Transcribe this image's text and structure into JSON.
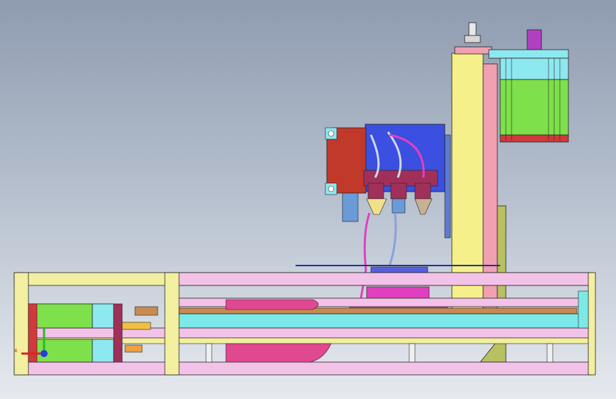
{
  "scene": {
    "type": "cad-assembly-side-view",
    "background_top": "#8f9bb0",
    "background_bottom": "#e6eaef",
    "axis_triad": {
      "x_color": "#e02020",
      "y_color": "#20c020",
      "z_color": "#2040e0"
    }
  },
  "colors": {
    "frame_rail": "#f3c2e8",
    "frame_yellow": "#f2f0a0",
    "cyan": "#7de8e8",
    "green": "#7ee04a",
    "column": "#f5f08a",
    "column_pink": "#f0a0b0",
    "motor_green": "#7ee04a",
    "motor_cyan": "#8ee8f0",
    "motor_red": "#d03a3a",
    "gripper_red": "#c0392b",
    "plate_blue": "#3b4fe0",
    "magenta": "#e040c0",
    "maroon": "#a0305a",
    "brown": "#c88a50",
    "olive": "#b8c060"
  }
}
